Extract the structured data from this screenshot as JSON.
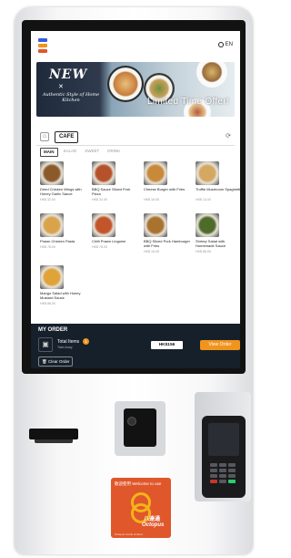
{
  "header": {
    "language_label": "EN",
    "logo_colors": [
      "#3b5bdb",
      "#f0941e",
      "#e0572b"
    ]
  },
  "banner": {
    "badge": "NEW",
    "subtitle": "Authentic Style of Home Kitchen",
    "offer": "Limited Time Offer!"
  },
  "nav": {
    "category": "CAFE",
    "subtabs": [
      "MAIN",
      "SALAD",
      "SWEET",
      "DRINK"
    ],
    "active_subtab": "MAIN"
  },
  "menu": {
    "items": [
      {
        "name": "Dried Chicken Wings with Honey Garlic Sauce",
        "price": "HK$ 32.00",
        "color": "#8b5a2b"
      },
      {
        "name": "BBQ Sauce Sliced Pork Pizza",
        "price": "HK$ 32.00",
        "color": "#b5522b"
      },
      {
        "name": "Cheese Burger with Fries",
        "price": "HK$ 16.00",
        "color": "#c88a3a"
      },
      {
        "name": "Truffle Mushroom Spaghetti",
        "price": "HK$ 13.00",
        "color": "#d4a862"
      },
      {
        "name": "Prawn Chicken Pasta",
        "price": "HK$ 78.00",
        "color": "#d9a34c"
      },
      {
        "name": "Chilli Prawn Linguine",
        "price": "HK$ 78.00",
        "color": "#c2552c"
      },
      {
        "name": "BBQ Sliced Pork Hamburger with Fries",
        "price": "HK$ 16.00",
        "color": "#a8722f"
      },
      {
        "name": "Shrimp Salad with Homemade Sauce",
        "price": "HK$ 88.00",
        "color": "#4f6b2a"
      },
      {
        "name": "Mango Salad with Honey Mustard Sauce",
        "price": "HK$ 88.00",
        "color": "#e0a33a"
      }
    ]
  },
  "order": {
    "title": "MY ORDER",
    "total_items_label": "Total Items",
    "total_items_sub": "Take Away",
    "count": "1",
    "total": "HK$156",
    "view_label": "View Order",
    "clear_label": "Clear Order",
    "accent": "#f0941e"
  },
  "octopus": {
    "top_text": "歡迎使用  Welcome to use",
    "brand_zh": "八達通",
    "brand_en": "Octopus",
    "fine_print": "Octopus Cards Limited"
  }
}
